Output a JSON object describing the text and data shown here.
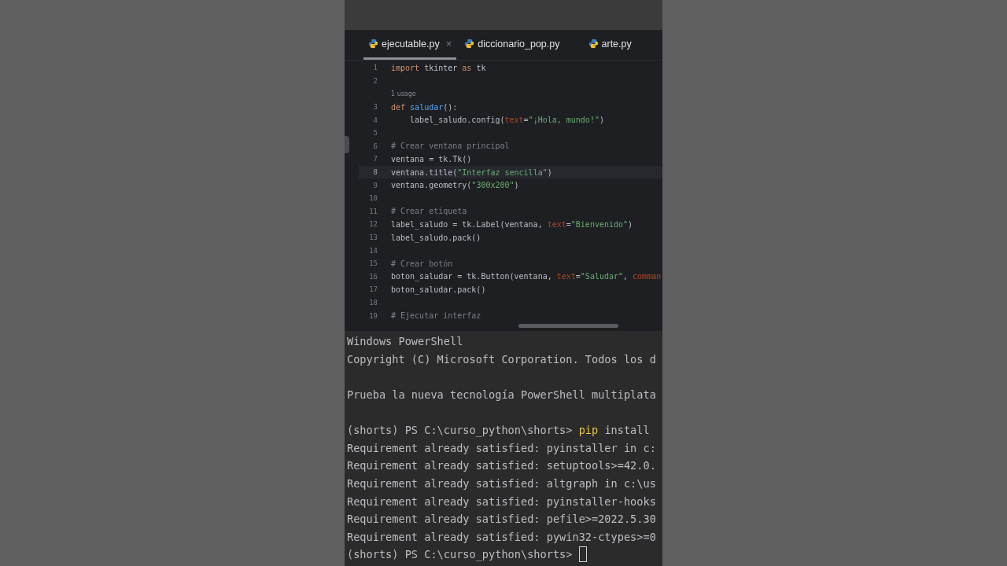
{
  "tabs": [
    {
      "label": "ejecutable.py",
      "selected": true,
      "close": "×"
    },
    {
      "label": "diccionario_pop.py",
      "selected": false
    },
    {
      "label": "arte.py",
      "selected": false
    }
  ],
  "editor": {
    "lines": [
      {
        "kind": "code",
        "number": "1",
        "current": false,
        "segments": [
          {
            "text": "import",
            "kind": "keyword"
          },
          {
            "text": " tkinter ",
            "kind": "plain"
          },
          {
            "text": "as",
            "kind": "keyword"
          },
          {
            "text": " tk",
            "kind": "plain"
          }
        ]
      },
      {
        "kind": "code",
        "number": "2",
        "current": false
      },
      {
        "kind": "hint",
        "text": "1 usage"
      },
      {
        "kind": "code",
        "number": "3",
        "current": false,
        "segments": [
          {
            "text": "def ",
            "kind": "keyword"
          },
          {
            "text": "saludar",
            "kind": "func"
          },
          {
            "text": "():",
            "kind": "plain"
          }
        ]
      },
      {
        "kind": "code",
        "number": "4",
        "current": false,
        "segments": [
          {
            "text": "    label_saludo.config(",
            "kind": "plain"
          },
          {
            "text": "text",
            "kind": "param"
          },
          {
            "text": "=",
            "kind": "plain"
          },
          {
            "text": "\"¡Hola, mundo!\"",
            "kind": "string"
          },
          {
            "text": ")",
            "kind": "plain"
          }
        ]
      },
      {
        "kind": "code",
        "number": "5",
        "current": false
      },
      {
        "kind": "code",
        "number": "6",
        "current": false,
        "segments": [
          {
            "text": "# Crear ventana principal",
            "kind": "comment"
          }
        ]
      },
      {
        "kind": "code",
        "number": "7",
        "current": false,
        "segments": [
          {
            "text": "ventana = tk.Tk()",
            "kind": "plain"
          }
        ]
      },
      {
        "kind": "code",
        "number": "8",
        "current": true,
        "segments": [
          {
            "text": "ventana.title(",
            "kind": "plain"
          },
          {
            "text": "\"Interfaz sencilla\"",
            "kind": "string"
          },
          {
            "text": ")",
            "kind": "plain"
          }
        ]
      },
      {
        "kind": "code",
        "number": "9",
        "current": false,
        "segments": [
          {
            "text": "ventana.geometry(",
            "kind": "plain"
          },
          {
            "text": "\"300x200\"",
            "kind": "string"
          },
          {
            "text": ")",
            "kind": "plain"
          }
        ]
      },
      {
        "kind": "code",
        "number": "10",
        "current": false
      },
      {
        "kind": "code",
        "number": "11",
        "current": false,
        "segments": [
          {
            "text": "# Crear etiqueta",
            "kind": "comment"
          }
        ]
      },
      {
        "kind": "code",
        "number": "12",
        "current": false,
        "segments": [
          {
            "text": "label_saludo = tk.Label(ventana, ",
            "kind": "plain"
          },
          {
            "text": "text",
            "kind": "param"
          },
          {
            "text": "=",
            "kind": "plain"
          },
          {
            "text": "\"Bienvenido\"",
            "kind": "string"
          },
          {
            "text": ")",
            "kind": "plain"
          }
        ]
      },
      {
        "kind": "code",
        "number": "13",
        "current": false,
        "segments": [
          {
            "text": "label_saludo.pack()",
            "kind": "plain"
          }
        ]
      },
      {
        "kind": "code",
        "number": "14",
        "current": false
      },
      {
        "kind": "code",
        "number": "15",
        "current": false,
        "segments": [
          {
            "text": "# Crear botón",
            "kind": "comment"
          }
        ]
      },
      {
        "kind": "code",
        "number": "16",
        "current": false,
        "segments": [
          {
            "text": "boton_saludar = tk.Button(ventana, ",
            "kind": "plain"
          },
          {
            "text": "text",
            "kind": "param"
          },
          {
            "text": "=",
            "kind": "plain"
          },
          {
            "text": "\"Saludar\"",
            "kind": "string"
          },
          {
            "text": ", ",
            "kind": "plain"
          },
          {
            "text": "comman",
            "kind": "param"
          }
        ]
      },
      {
        "kind": "code",
        "number": "17",
        "current": false,
        "segments": [
          {
            "text": "boton_saludar.pack()",
            "kind": "plain"
          }
        ]
      },
      {
        "kind": "code",
        "number": "18",
        "current": false
      },
      {
        "kind": "code",
        "number": "19",
        "current": false,
        "segments": [
          {
            "text": "# Ejecutar interfaz",
            "kind": "comment"
          }
        ]
      }
    ]
  },
  "terminal": {
    "lines": [
      {
        "kind": "text",
        "segments": [
          {
            "text": "Windows PowerShell",
            "kind": "plain"
          }
        ]
      },
      {
        "kind": "text",
        "segments": [
          {
            "text": "Copyright (C) Microsoft Corporation. Todos los d",
            "kind": "plain"
          }
        ]
      },
      {
        "kind": "blank"
      },
      {
        "kind": "text",
        "segments": [
          {
            "text": "Prueba la nueva tecnología PowerShell multiplata",
            "kind": "plain"
          }
        ]
      },
      {
        "kind": "blank"
      },
      {
        "kind": "text",
        "segments": [
          {
            "text": "(shorts) PS C:\\curso_python\\shorts> ",
            "kind": "plain"
          },
          {
            "text": "pip",
            "kind": "command"
          },
          {
            "text": " install",
            "kind": "plain"
          }
        ]
      },
      {
        "kind": "text",
        "segments": [
          {
            "text": "Requirement already satisfied: pyinstaller in c:",
            "kind": "plain"
          }
        ]
      },
      {
        "kind": "text",
        "segments": [
          {
            "text": "Requirement already satisfied: setuptools>=42.0.",
            "kind": "plain"
          }
        ]
      },
      {
        "kind": "text",
        "segments": [
          {
            "text": "Requirement already satisfied: altgraph in c:\\us",
            "kind": "plain"
          }
        ]
      },
      {
        "kind": "text",
        "segments": [
          {
            "text": "Requirement already satisfied: pyinstaller-hooks",
            "kind": "plain"
          }
        ]
      },
      {
        "kind": "text",
        "segments": [
          {
            "text": "Requirement already satisfied: pefile>=2022.5.30",
            "kind": "plain"
          }
        ]
      },
      {
        "kind": "text",
        "segments": [
          {
            "text": "Requirement already satisfied: pywin32-ctypes>=0",
            "kind": "plain"
          }
        ]
      },
      {
        "kind": "prompt",
        "cursor": true,
        "segments": [
          {
            "text": "(shorts) PS C:\\curso_python\\shorts>",
            "kind": "plain"
          }
        ]
      }
    ]
  }
}
